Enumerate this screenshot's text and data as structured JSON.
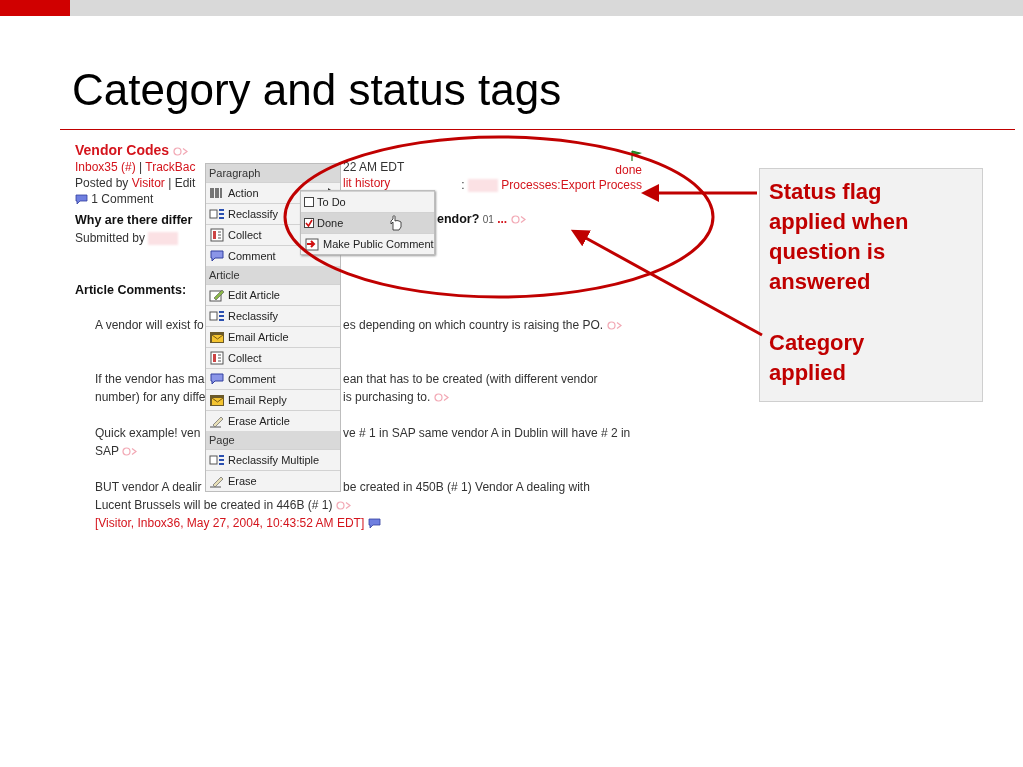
{
  "slide": {
    "title": "Category and status tags"
  },
  "article": {
    "header_rows": [
      {
        "kind": "title",
        "left": [
          {
            "kind": "link-bold",
            "text": "Vendor Codes"
          },
          {
            "kind": "tag"
          }
        ]
      },
      {
        "kind": "meta",
        "left": [
          {
            "kind": "link",
            "text": "Inbox35 (#)"
          },
          {
            "kind": "text",
            "text": "|"
          },
          {
            "kind": "link",
            "text": "TrackBac"
          }
        ],
        "right": [
          {
            "kind": "text",
            "text": "22 AM EDT"
          }
        ]
      },
      {
        "kind": "meta",
        "left": [
          {
            "kind": "text",
            "text": "Posted by"
          },
          {
            "kind": "link",
            "text": "Visitor"
          },
          {
            "kind": "text",
            "text": "| Edit"
          }
        ],
        "right": [
          {
            "kind": "link",
            "text": "lit history"
          }
        ]
      },
      {
        "kind": "meta",
        "left": [
          {
            "kind": "comment-icon"
          },
          {
            "kind": "text",
            "text": "1 Comment"
          }
        ]
      }
    ],
    "status_lines": [
      [
        {
          "kind": "flag"
        }
      ],
      [
        {
          "kind": "link",
          "text": "done"
        }
      ],
      [
        {
          "kind": "text",
          "text": ":"
        },
        {
          "kind": "blur"
        },
        {
          "kind": "link",
          "text": "Processes:Export Process"
        }
      ]
    ],
    "body_rows": [
      {
        "kind": "question",
        "left": [
          {
            "kind": "bold",
            "text": "Why are there differ"
          }
        ],
        "right": [
          {
            "kind": "bold",
            "text": "endor?"
          },
          {
            "kind": "small",
            "text": "01"
          },
          {
            "kind": "link-bold",
            "text": "..."
          },
          {
            "kind": "tag"
          }
        ]
      },
      {
        "kind": "sub",
        "left": [
          {
            "kind": "text",
            "text": "Submitted by"
          },
          {
            "kind": "blur"
          }
        ]
      },
      {
        "kind": "section",
        "left": [
          {
            "kind": "bold",
            "text": "Article Comments:"
          }
        ]
      },
      {
        "kind": "para",
        "left": [
          {
            "kind": "text",
            "text": "A vendor will exist fo"
          }
        ],
        "right": [
          {
            "kind": "text",
            "text": "es depending on which country is raising the PO."
          },
          {
            "kind": "tag"
          }
        ]
      },
      {
        "kind": "para-gap",
        "left": [
          {
            "kind": "text",
            "text": "If the vendor has ma"
          }
        ],
        "right": [
          {
            "kind": "text",
            "text": "ean that has to be created (with different vendor"
          }
        ]
      },
      {
        "kind": "cont",
        "left": [
          {
            "kind": "text",
            "text": "number) for any diffe"
          }
        ],
        "right": [
          {
            "kind": "text",
            "text": "is purchasing to."
          },
          {
            "kind": "tag"
          }
        ]
      },
      {
        "kind": "para",
        "left": [
          {
            "kind": "text",
            "text": "Quick example! ven"
          }
        ],
        "right": [
          {
            "kind": "text",
            "text": "ve # 1 in SAP same vendor A in Dublin will have # 2 in"
          }
        ]
      },
      {
        "kind": "cont",
        "left": [
          {
            "kind": "text",
            "text": "SAP"
          },
          {
            "kind": "tag"
          }
        ]
      },
      {
        "kind": "para",
        "left": [
          {
            "kind": "text",
            "text": "BUT vendor A dealir"
          }
        ],
        "right": [
          {
            "kind": "text",
            "text": "be created in 450B (# 1) Vendor A dealing with"
          }
        ]
      },
      {
        "kind": "cont",
        "left": [
          {
            "kind": "text",
            "text": "Lucent Brussels will be created in 446B (# 1)"
          },
          {
            "kind": "tag"
          }
        ]
      },
      {
        "kind": "cont",
        "left": [
          {
            "kind": "link",
            "text": "[Visitor, Inbox36, May 27, 2004, 10:43:52 AM EDT]"
          },
          {
            "kind": "comment-icon"
          }
        ]
      }
    ]
  },
  "menu": {
    "sections": [
      {
        "header": "Paragraph",
        "items": [
          {
            "kind": "action",
            "label": "Action",
            "has_submenu": true
          },
          {
            "kind": "reclassify",
            "label": "Reclassify",
            "has_submenu": false
          },
          {
            "kind": "collect",
            "label": "Collect",
            "has_submenu": false
          },
          {
            "kind": "comment",
            "label": "Comment",
            "has_submenu": false
          }
        ]
      },
      {
        "header": "Article",
        "items": [
          {
            "kind": "edit",
            "label": "Edit Article",
            "has_submenu": false
          },
          {
            "kind": "reclassify",
            "label": "Reclassify",
            "has_submenu": false
          },
          {
            "kind": "email",
            "label": "Email Article",
            "has_submenu": false
          },
          {
            "kind": "collect",
            "label": "Collect",
            "has_submenu": false
          },
          {
            "kind": "comment",
            "label": "Comment",
            "has_submenu": false
          },
          {
            "kind": "email",
            "label": "Email Reply",
            "has_submenu": false
          },
          {
            "kind": "erase",
            "label": "Erase Article",
            "has_submenu": false
          }
        ]
      },
      {
        "header": "Page",
        "items": [
          {
            "kind": "reclassify",
            "label": "Reclassify Multiple",
            "has_submenu": false
          },
          {
            "kind": "erase",
            "label": "Erase",
            "has_submenu": false
          }
        ]
      }
    ]
  },
  "submenu": {
    "items": [
      {
        "kind": "check",
        "label": "To Do",
        "checked": false,
        "selected": false
      },
      {
        "kind": "check",
        "label": "Done",
        "checked": true,
        "selected": true
      },
      {
        "kind": "public",
        "label": "Make Public Comment",
        "selected": false
      }
    ]
  },
  "callout": {
    "paragraphs": [
      "Status flag applied when question is answered",
      "Category applied"
    ]
  }
}
